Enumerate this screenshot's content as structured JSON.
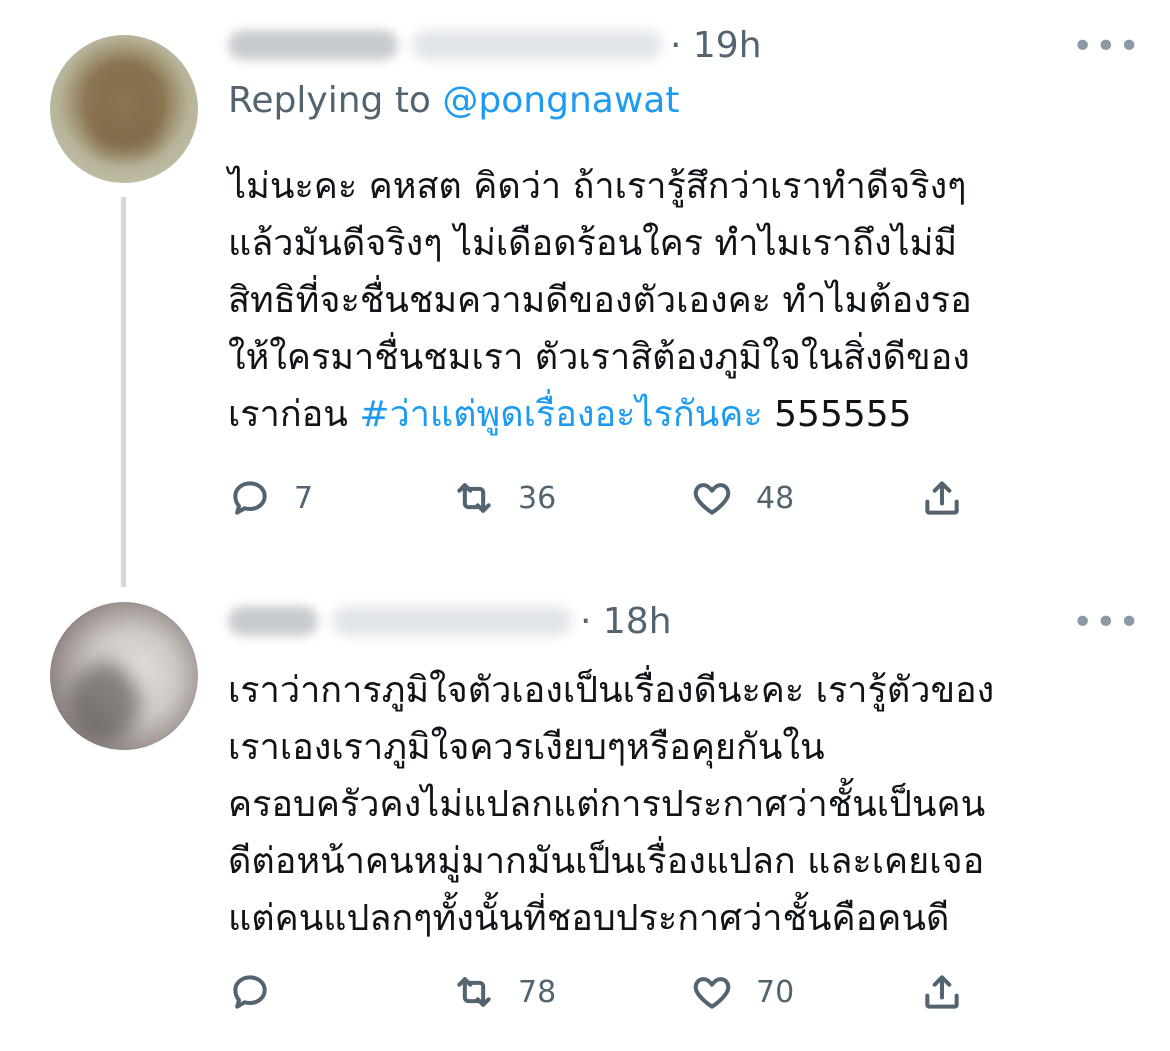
{
  "tweets": [
    {
      "time": "· 19h",
      "more": "•••",
      "replying_prefix": "Replying to ",
      "replying_handle": "@pongnawat",
      "lines": [
        "ไม่นะคะ คหสต คิดว่า ถ้าเรารู้สึกว่าเราทำดีจริงๆ",
        "แล้วมันดีจริงๆ ไม่เดือดร้อนใคร ทำไมเราถึงไม่มี",
        "สิทธิที่จะชื่นชมความดีของตัวเองคะ ทำไมต้องรอ",
        "ให้ใครมาชื่นชมเรา ตัวเราสิต้องภูมิใจในสิ่งดีของ"
      ],
      "last_line_prefix": "เราก่อน ",
      "hashtag": "#ว่าแต่พูดเรื่องอะไรกันคะ",
      "last_line_suffix": " 555555",
      "replies": "7",
      "retweets": "36",
      "likes": "48"
    },
    {
      "time": "· 18h",
      "more": "•••",
      "lines": [
        "เราว่าการภูมิใจตัวเองเป็นเรื่องดีนะคะ เรารู้ตัวของ",
        "เราเองเราภูมิใจควรเงียบๆหรือคุยกันใน",
        "ครอบครัวคงไม่แปลกแต่การประกาศว่าชั้นเป็นคน",
        "ดีต่อหน้าคนหมู่มากมันเป็นเรื่องแปลก และเคยเจอ",
        "แต่คนแปลกๆทั้งนั้นที่ชอบประกาศว่าชั้นคือคนดี"
      ],
      "retweets": "78",
      "likes": "70"
    }
  ],
  "colors": {
    "link": "#1d9bf0",
    "secondary": "#536471",
    "text": "#0f1419"
  },
  "icons": [
    "reply-icon",
    "retweet-icon",
    "like-icon",
    "share-icon",
    "more-icon"
  ]
}
